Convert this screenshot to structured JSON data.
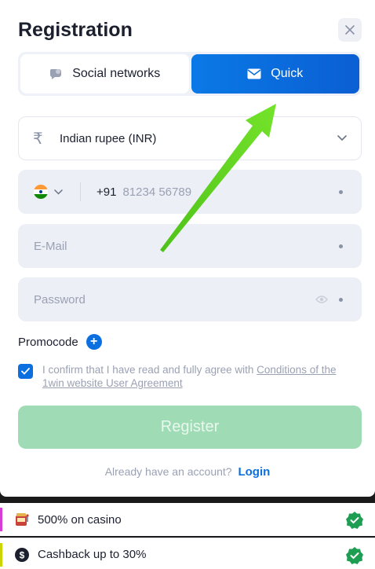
{
  "modal": {
    "title": "Registration",
    "close_icon": "close-icon"
  },
  "tabs": [
    {
      "label": "Social networks",
      "icon": "chat-bubble-icon",
      "active": false
    },
    {
      "label": "Quick",
      "icon": "envelope-icon",
      "active": true
    }
  ],
  "form": {
    "currency": {
      "symbol": "₹",
      "value": "Indian rupee (INR)"
    },
    "phone": {
      "country_code": "+91",
      "placeholder": "81234 56789"
    },
    "email": {
      "placeholder": "E-Mail"
    },
    "password": {
      "placeholder": "Password"
    },
    "promocode_label": "Promocode",
    "agree_text": "I confirm that I have read and fully agree with ",
    "agree_link": "Conditions of the 1win website User Agreement",
    "agree_checked": true,
    "register_label": "Register"
  },
  "login": {
    "question": "Already have an account?",
    "link": "Login"
  },
  "bonuses": [
    {
      "label": "500% on casino",
      "icon": "slot-machine-icon",
      "edge_color": "#d63cd6"
    },
    {
      "label": "Cashback up to 30%",
      "icon": "dollar-coin-icon",
      "edge_color": "#c9d600"
    }
  ],
  "colors": {
    "accent_blue": "#0b6fe0",
    "register_green": "#9fdcb6",
    "annotation_arrow": "#5fd31f",
    "badge_green": "#1e9e52"
  }
}
